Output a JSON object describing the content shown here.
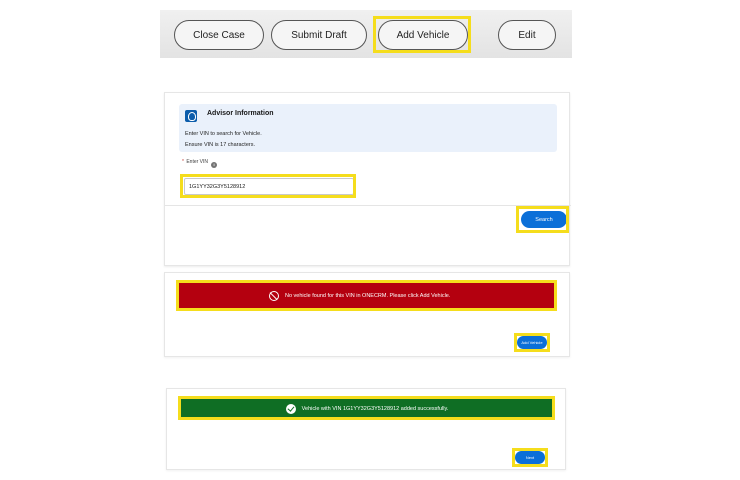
{
  "action_bar": {
    "close_case": "Close Case",
    "submit_draft": "Submit Draft",
    "add_vehicle": "Add Vehicle",
    "edit": "Edit"
  },
  "advisor": {
    "title": "Advisor Information",
    "line1": "Enter VIN to search for Vehicle.",
    "line2": "Ensure VIN is 17 characters.",
    "vin_label": "Enter VIN",
    "vin_required_mark": "*",
    "vin_value": "1G1YY32G3Y5128912",
    "search_label": "Search"
  },
  "error_card": {
    "message": "No vehicle found for this VIN in ONECRM. Please click Add Vehicle.",
    "button_label": "Add Vehicle"
  },
  "success_card": {
    "message": "Vehicle with VIN 1G1YY32G3Y5128912 added successfully.",
    "button_label": "Next"
  },
  "colors": {
    "highlight": "#f5dd1c",
    "brand_blue": "#0b6fd8",
    "error_red": "#b4000f",
    "success_green": "#0f6e24"
  },
  "icons": [
    "advisor-icon",
    "help-icon",
    "ban-icon",
    "check-circle-icon"
  ]
}
